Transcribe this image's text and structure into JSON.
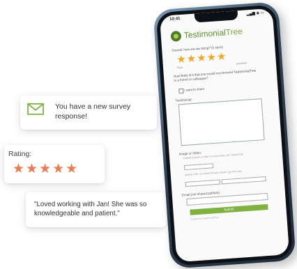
{
  "notification": {
    "icon": "envelope-icon",
    "message": "You have a new survey response!"
  },
  "rating_card": {
    "label": "Rating:",
    "stars": 5,
    "stars_text": "★★★★★",
    "star_color": "#ee7a4f"
  },
  "quote_card": {
    "text": "\"Loved working with Jan! She was so knowledgeable and patient.\""
  },
  "phone": {
    "status_time": "10:41",
    "status_icons": "▂▄▆ ◉ ▭",
    "logo_name_a": "Testimonial",
    "logo_name_b": "Tree",
    "brand_color": "#5e8e2a",
    "q1": "Overall, how are we doing? (5 stars)",
    "stars_text": "★★★★★",
    "stars": 5,
    "scale_low": "Poor",
    "scale_high": "Excellent",
    "q2": "How likely is it that you would recommend TestimonialTree to a friend or colleague?",
    "checkbox_label": "I want to share",
    "q3": "Testimonial:",
    "q4": "Image or Video:",
    "fine1": "Upload a photo or video to accompany your testimonial.",
    "fine2": "Upload a file. Accepted formats include .jpg and .png.",
    "q5": "Email (not shared publicly)",
    "submit": "Submit",
    "footer": "Powered by TestimonialTree"
  }
}
